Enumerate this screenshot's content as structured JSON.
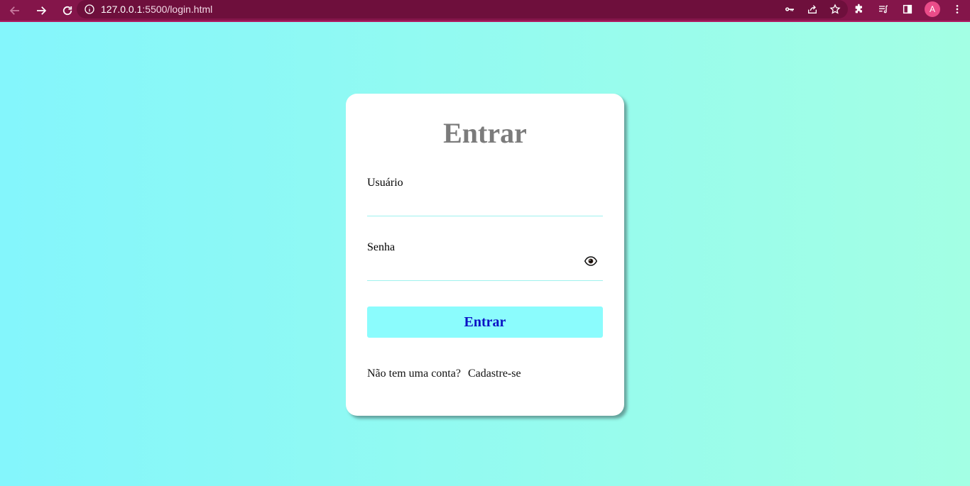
{
  "browser": {
    "url_host": "127.0.0.1",
    "url_path": ":5500/login.html",
    "profile_initial": "A",
    "icons": [
      "back-icon",
      "forward-icon",
      "reload-icon",
      "info-icon",
      "key-icon",
      "share-icon",
      "star-icon",
      "extensions-icon",
      "reading-list-icon",
      "side-panel-icon",
      "menu-icon"
    ]
  },
  "login": {
    "title": "Entrar",
    "username_label": "Usuário",
    "password_label": "Senha",
    "submit_label": "Entrar",
    "no_account_text": "Não tem uma conta?",
    "signup_link": "Cadastre-se"
  },
  "colors": {
    "chrome_bg": "#84154a",
    "gradient_start": "#84f6fc",
    "gradient_end": "#a3ffe4",
    "button_bg": "#8bfcfd",
    "button_text": "#0b12c5"
  }
}
